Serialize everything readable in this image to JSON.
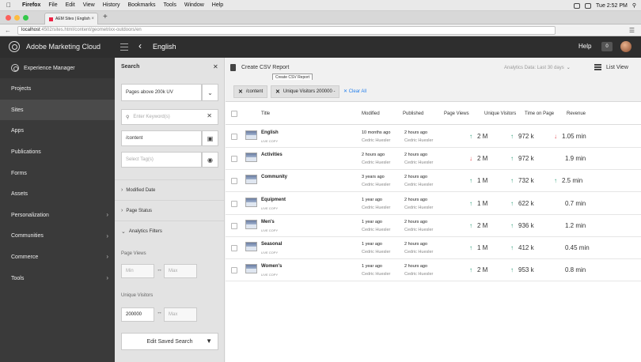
{
  "mac_menu": {
    "apple": "",
    "items": [
      "Firefox",
      "File",
      "Edit",
      "View",
      "History",
      "Bookmarks",
      "Tools",
      "Window",
      "Help"
    ],
    "clock": "Tue 2:52 PM"
  },
  "browser": {
    "tab_title": "AEM Sites | English",
    "new_tab": "+",
    "url_host": "localhost",
    "url_path": ":4502/sites.html/content/geometrixx-outdoors/en"
  },
  "header": {
    "brand": "Adobe Marketing Cloud",
    "title": "English",
    "help": "Help",
    "notifications": "0"
  },
  "rail": {
    "items": [
      {
        "label": "Experience Manager",
        "chevron": false
      },
      {
        "label": "Projects",
        "chevron": false
      },
      {
        "label": "Sites",
        "chevron": false
      },
      {
        "label": "Apps",
        "chevron": false
      },
      {
        "label": "Publications",
        "chevron": false
      },
      {
        "label": "Forms",
        "chevron": false
      },
      {
        "label": "Assets",
        "chevron": false
      },
      {
        "label": "Personalization",
        "chevron": true
      },
      {
        "label": "Communities",
        "chevron": true
      },
      {
        "label": "Commerce",
        "chevron": true
      },
      {
        "label": "Tools",
        "chevron": true
      }
    ]
  },
  "search": {
    "title": "Search",
    "saved_search": "Pages above 200k UV",
    "keyword_placeholder": "Enter Keyword(s)",
    "path_value": "/content",
    "tags_placeholder": "Select Tag(s)",
    "facets": {
      "modified_date": "Modified Date",
      "page_status": "Page Status",
      "analytics_filters": "Analytics Filters"
    },
    "page_views_label": "Page Views",
    "page_views_min": "Min",
    "page_views_max": "Max",
    "unique_visitors_label": "Unique Visitors",
    "unique_visitors_min": "200000",
    "unique_visitors_max": "Max",
    "edit_saved": "Edit Saved Search"
  },
  "toolbar": {
    "create_csv": "Create CSV Report",
    "tooltip": "Create CSV Report",
    "analytics_date": "Analytics Data: Last 30 days",
    "list_view": "List View"
  },
  "filters": {
    "chips": [
      "/content",
      "Unique Visitors 200000 -"
    ],
    "clear_all": "Clear All"
  },
  "table": {
    "columns": [
      "Title",
      "Modified",
      "Published",
      "Page Views",
      "Unique Visitors",
      "Time on Page",
      "Revenue"
    ],
    "rows": [
      {
        "title": "English",
        "sub": "LIVE COPY",
        "modified": "10 months ago",
        "modified_by": "Cedric Huesler",
        "published": "2 hours ago",
        "published_by": "Cedric Huesler",
        "views_dir": "up",
        "views": "2 M",
        "uv_dir": "up",
        "uv": "972 k",
        "top_dir": "down",
        "top": "1.05 min"
      },
      {
        "title": "Activities",
        "sub": "",
        "modified": "2 hours ago",
        "modified_by": "Cedric Huesler",
        "published": "2 hours ago",
        "published_by": "Cedric Huesler",
        "views_dir": "down",
        "views": "2 M",
        "uv_dir": "up",
        "uv": "972 k",
        "top_dir": "",
        "top": "1.9 min"
      },
      {
        "title": "Community",
        "sub": "",
        "modified": "3 years ago",
        "modified_by": "Cedric Huesler",
        "published": "2 hours ago",
        "published_by": "Cedric Huesler",
        "views_dir": "up",
        "views": "1 M",
        "uv_dir": "up",
        "uv": "732 k",
        "top_dir": "up",
        "top": "2.5 min"
      },
      {
        "title": "Equipment",
        "sub": "LIVE COPY",
        "modified": "1 year ago",
        "modified_by": "Cedric Huesler",
        "published": "2 hours ago",
        "published_by": "Cedric Huesler",
        "views_dir": "up",
        "views": "1 M",
        "uv_dir": "up",
        "uv": "622 k",
        "top_dir": "",
        "top": "0.7 min"
      },
      {
        "title": "Men's",
        "sub": "LIVE COPY",
        "modified": "1 year ago",
        "modified_by": "Cedric Huesler",
        "published": "2 hours ago",
        "published_by": "Cedric Huesler",
        "views_dir": "up",
        "views": "2 M",
        "uv_dir": "up",
        "uv": "936 k",
        "top_dir": "",
        "top": "1.2 min"
      },
      {
        "title": "Seasonal",
        "sub": "LIVE COPY",
        "modified": "1 year ago",
        "modified_by": "Cedric Huesler",
        "published": "2 hours ago",
        "published_by": "Cedric Huesler",
        "views_dir": "up",
        "views": "1 M",
        "uv_dir": "up",
        "uv": "412 k",
        "top_dir": "",
        "top": "0.45 min"
      },
      {
        "title": "Women's",
        "sub": "LIVE COPY",
        "modified": "1 year ago",
        "modified_by": "Cedric Huesler",
        "published": "2 hours ago",
        "published_by": "Cedric Huesler",
        "views_dir": "up",
        "views": "2 M",
        "uv_dir": "up",
        "uv": "953 k",
        "top_dir": "",
        "top": "0.8 min"
      }
    ]
  },
  "colors": {
    "trend_up": "#2d9d78",
    "trend_down": "#e34850",
    "link": "#2680eb",
    "rail_bg": "#3a3a3a",
    "header_bg": "#2e2e2e"
  }
}
